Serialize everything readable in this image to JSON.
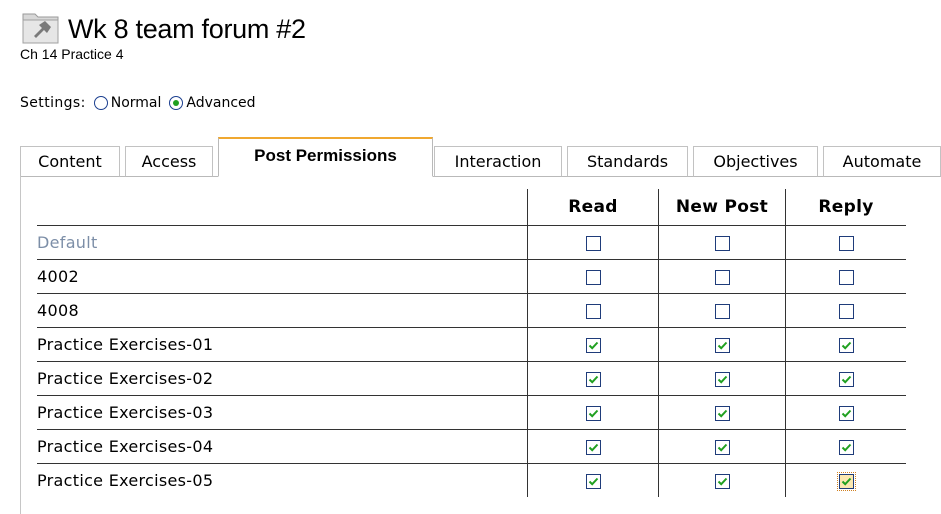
{
  "header": {
    "title": "Wk 8 team forum #2",
    "subtitle": "Ch 14 Practice 4"
  },
  "settings": {
    "label": "Settings:",
    "options": [
      {
        "label": "Normal",
        "checked": false
      },
      {
        "label": "Advanced",
        "checked": true
      }
    ]
  },
  "tabs": [
    {
      "label": "Content",
      "active": false
    },
    {
      "label": "Access",
      "active": false
    },
    {
      "label": "Post Permissions",
      "active": true
    },
    {
      "label": "Interaction",
      "active": false
    },
    {
      "label": "Standards",
      "active": false
    },
    {
      "label": "Objectives",
      "active": false
    },
    {
      "label": "Automate",
      "active": false
    }
  ],
  "permissions": {
    "columns": [
      "Read",
      "New Post",
      "Reply"
    ],
    "rows": [
      {
        "name": "Default",
        "read": false,
        "new_post": false,
        "reply": false
      },
      {
        "name": "4002",
        "read": false,
        "new_post": false,
        "reply": false
      },
      {
        "name": "4008",
        "read": false,
        "new_post": false,
        "reply": false
      },
      {
        "name": "Practice Exercises-01",
        "read": true,
        "new_post": true,
        "reply": true
      },
      {
        "name": "Practice Exercises-02",
        "read": true,
        "new_post": true,
        "reply": true
      },
      {
        "name": "Practice Exercises-03",
        "read": true,
        "new_post": true,
        "reply": true
      },
      {
        "name": "Practice Exercises-04",
        "read": true,
        "new_post": true,
        "reply": true
      },
      {
        "name": "Practice Exercises-05",
        "read": true,
        "new_post": true,
        "reply": true
      }
    ]
  },
  "colors": {
    "active_tab_accent": "#f0a830",
    "check_mark": "#20a020",
    "default_row_text": "#7c8ea7"
  }
}
